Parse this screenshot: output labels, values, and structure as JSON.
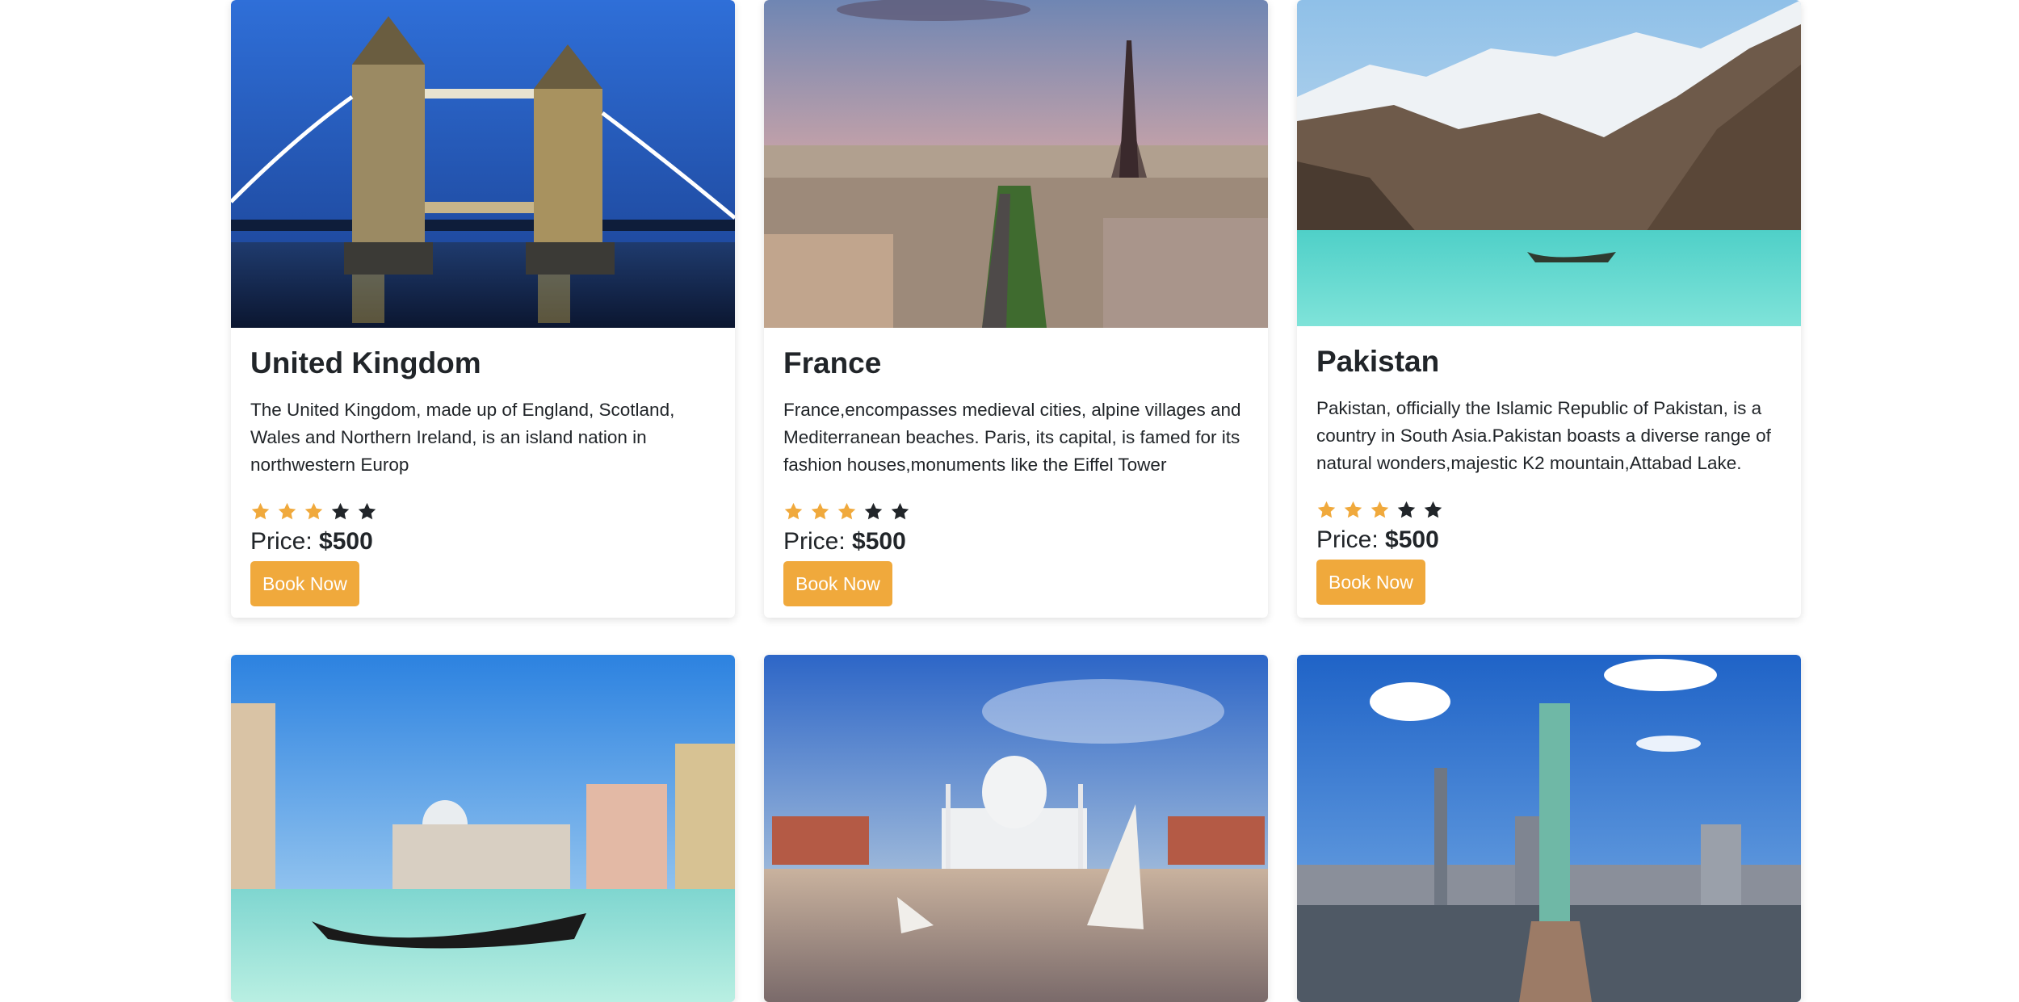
{
  "destinations": [
    {
      "title": "United Kingdom",
      "description": "The United Kingdom, made up of England, Scotland, Wales and Northern Ireland, is an island nation in northwestern Europ",
      "rating": 3,
      "rating_max": 5,
      "price_label": "Price:",
      "price_value": "$500",
      "button_label": "Book Now",
      "image": "tower-bridge-photo"
    },
    {
      "title": "France",
      "description": "France,encompasses medieval cities, alpine villages and Mediterranean beaches. Paris, its capital, is famed for its fashion houses,monuments like the Eiffel Tower",
      "rating": 3,
      "rating_max": 5,
      "price_label": "Price:",
      "price_value": "$500",
      "button_label": "Book Now",
      "image": "eiffel-tower-photo"
    },
    {
      "title": "Pakistan",
      "description": "Pakistan, officially the Islamic Republic of Pakistan, is a country in South Asia.Pakistan boasts a diverse range of natural wonders,majestic K2 mountain,Attabad Lake.",
      "rating": 3,
      "rating_max": 5,
      "price_label": "Price:",
      "price_value": "$500",
      "button_label": "Book Now",
      "image": "attabad-lake-photo"
    },
    {
      "image": "venice-gondola-photo"
    },
    {
      "image": "taj-mahal-photo"
    },
    {
      "image": "statue-of-liberty-photo"
    }
  ],
  "colors": {
    "accent": "#f0a93c",
    "star_filled": "#f0a93c",
    "star_empty": "#212529",
    "text": "#212529"
  },
  "icons": {
    "star": "star-icon"
  }
}
